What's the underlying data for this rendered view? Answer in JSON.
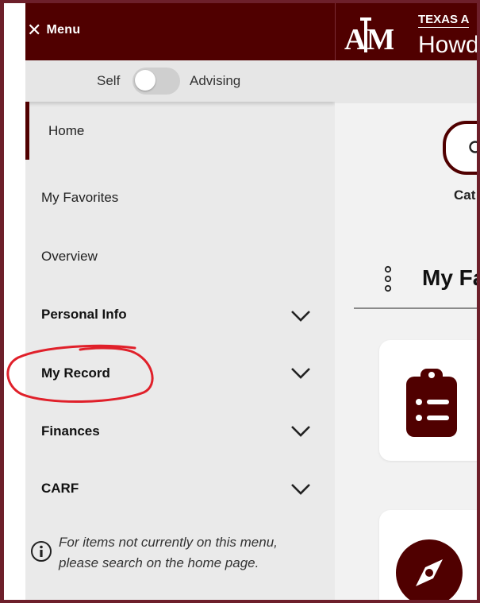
{
  "header": {
    "menu_label": "Menu",
    "university": "TEXAS A",
    "app_title": "Howd",
    "logo": "atm-logo",
    "colors": {
      "maroon": "#500000"
    }
  },
  "toggle": {
    "left_label": "Self",
    "right_label": "Advising",
    "state": "Self"
  },
  "sidebar": {
    "items": [
      {
        "label": "Home",
        "expandable": false,
        "active": true
      },
      {
        "label": "My Favorites",
        "expandable": false
      },
      {
        "label": "Overview",
        "expandable": false
      },
      {
        "label": "Personal Info",
        "expandable": true
      },
      {
        "label": "My Record",
        "expandable": true
      },
      {
        "label": "Finances",
        "expandable": true
      },
      {
        "label": "CARF",
        "expandable": true
      }
    ],
    "help_text_line1": "For items not currently on this menu,",
    "help_text_line2": "please search on the home page."
  },
  "main": {
    "search_label": "Cat",
    "favorites_heading": "My Fa",
    "cards": [
      {
        "icon": "clipboard-list-icon"
      },
      {
        "icon": "compass-icon"
      }
    ]
  },
  "annotation": {
    "type": "red-ellipse",
    "color": "#e0202a",
    "target": "My Record"
  }
}
